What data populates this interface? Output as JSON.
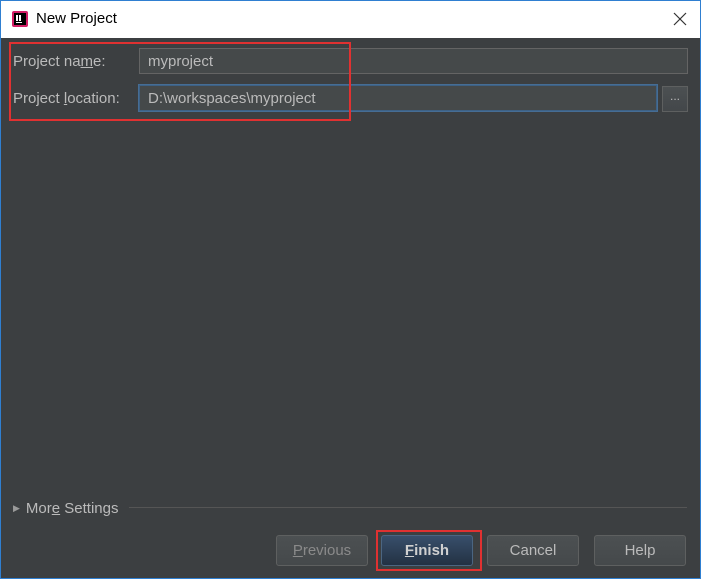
{
  "window": {
    "title": "New Project",
    "app_icon": "intellij-idea-icon"
  },
  "form": {
    "project_name_label_prefix": "Project na",
    "project_name_label_mnemonic": "m",
    "project_name_label_suffix": "e:",
    "project_name_value": "myproject",
    "project_location_label_prefix": "Project ",
    "project_location_label_mnemonic": "l",
    "project_location_label_suffix": "ocation:",
    "project_location_value": "D:\\workspaces\\myproject",
    "browse_label": "..."
  },
  "more_settings": {
    "label_prefix": "Mor",
    "label_mnemonic": "e",
    "label_suffix": " Settings",
    "icon": "triangle-right-icon"
  },
  "buttons": {
    "previous": {
      "mnemonic": "P",
      "rest": "revious"
    },
    "finish": {
      "mnemonic": "F",
      "rest": "inish"
    },
    "cancel": "Cancel",
    "help": "Help"
  },
  "colors": {
    "dialog_bg": "#3c3f41",
    "annotation_red": "#e03131",
    "default_button": "#2d4157",
    "text": "#bbbbbb"
  }
}
